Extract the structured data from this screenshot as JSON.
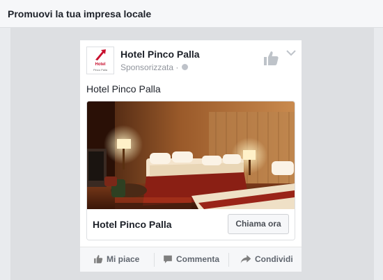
{
  "header": {
    "title": "Promuovi la tua impresa locale"
  },
  "post": {
    "page_name": "Hotel Pinco Palla",
    "sponsored_label": "Sponsorizzata",
    "dot": "·",
    "message": "Hotel Pinco Palla",
    "logo": {
      "line1": "Hotel",
      "line2": "Pinco Palla",
      "color": "#c8102e"
    },
    "cta": {
      "title": "Hotel Pinco Palla",
      "button_label": "Chiama ora"
    },
    "actions": [
      {
        "label": "Mi piace",
        "icon": "thumbs-up-icon"
      },
      {
        "label": "Commenta",
        "icon": "comment-icon"
      },
      {
        "label": "Condividi",
        "icon": "share-icon"
      }
    ]
  },
  "colors": {
    "link_text": "#1d2129",
    "secondary_text": "#90949c",
    "action_text": "#616770"
  }
}
